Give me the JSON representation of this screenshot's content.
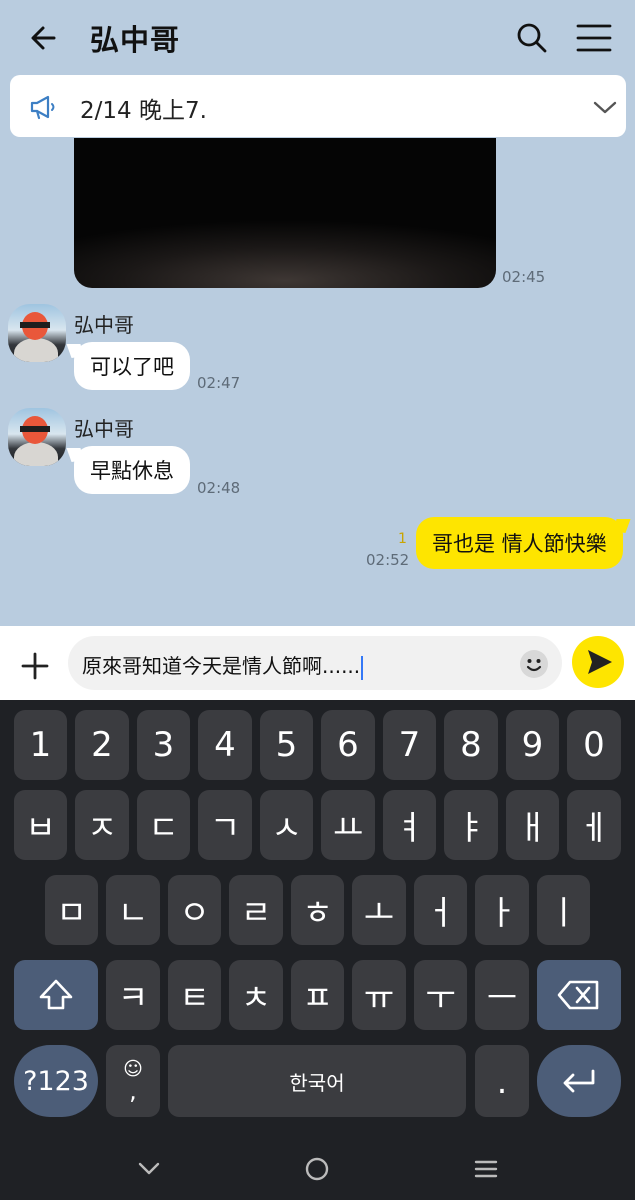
{
  "header": {
    "title": "弘中哥",
    "back_icon": "arrow-left-icon",
    "search_icon": "search-icon",
    "menu_icon": "hamburger-menu-icon"
  },
  "notice": {
    "text": "2/14 晚上7.",
    "icon": "megaphone-icon",
    "expand_icon": "chevron-down-icon"
  },
  "messages": {
    "video": {
      "time": "02:45"
    },
    "m1": {
      "sender": "弘中哥",
      "text": "可以了吧",
      "time": "02:47"
    },
    "m2": {
      "sender": "弘中哥",
      "text": "早點休息",
      "time": "02:48"
    },
    "m3": {
      "text": "哥也是 情人節快樂",
      "time": "02:52",
      "unread": "1"
    }
  },
  "composer": {
    "value": "原來哥知道今天是情人節啊......",
    "plus_icon": "plus-icon",
    "emoji_icon": "emoji-icon",
    "send_icon": "send-icon"
  },
  "keyboard": {
    "row1": [
      "1",
      "2",
      "3",
      "4",
      "5",
      "6",
      "7",
      "8",
      "9",
      "0"
    ],
    "row2": [
      "ㅂ",
      "ㅈ",
      "ㄷ",
      "ㄱ",
      "ㅅ",
      "ㅛ",
      "ㅕ",
      "ㅑ",
      "ㅐ",
      "ㅔ"
    ],
    "row3": [
      "ㅁ",
      "ㄴ",
      "ㅇ",
      "ㄹ",
      "ㅎ",
      "ㅗ",
      "ㅓ",
      "ㅏ",
      "ㅣ"
    ],
    "row4": [
      "ㅋ",
      "ㅌ",
      "ㅊ",
      "ㅍ",
      "ㅠ",
      "ㅜ",
      "ㅡ"
    ],
    "sym_label": "?123",
    "emoji_comma_top": "☺",
    "emoji_comma_bottom": ",",
    "space_label": "한국어",
    "period_label": ".",
    "shift_icon": "shift-icon",
    "backspace_icon": "backspace-icon",
    "enter_icon": "enter-icon"
  },
  "navbar": {
    "back_icon": "nav-back-chevron-icon",
    "home_icon": "nav-home-icon",
    "recents_icon": "nav-recents-icon"
  },
  "colors": {
    "chat_bg": "#b9ccdf",
    "outgoing_bubble": "#fee500",
    "keyboard_bg": "#1f2125",
    "key_bg": "#3b3c40",
    "func_key_bg": "#4c5d78"
  }
}
